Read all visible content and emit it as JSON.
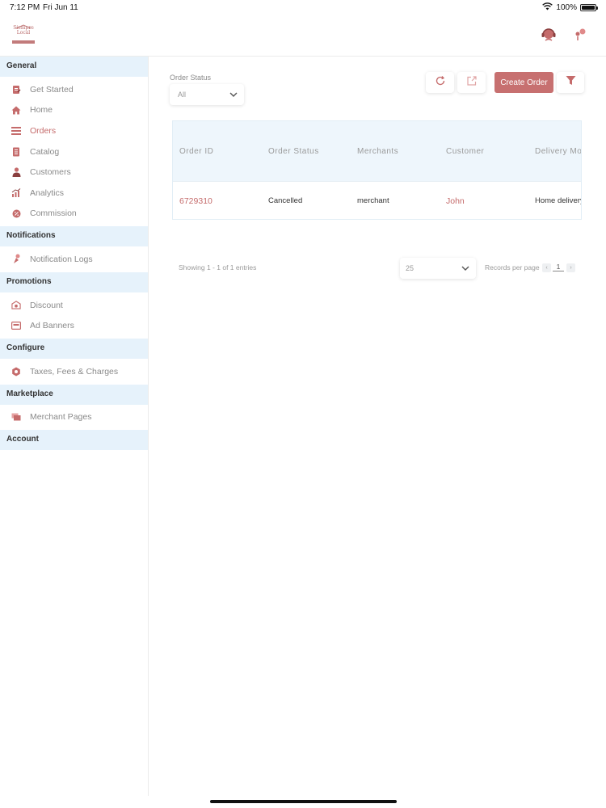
{
  "status_bar": {
    "time": "7:12 PM",
    "date": "Fri Jun 11",
    "battery": "100%",
    "battery_level": 1.0
  },
  "header": {
    "logo_text": "Siempre Local",
    "support_icon": "support-agent-icon",
    "notification_icon": "notification-icon"
  },
  "colors": {
    "accent": "#c56b6b",
    "button": "#c77070",
    "section_bg": "#e6f2fb",
    "table_header_bg": "#eef6fc"
  },
  "sidebar": {
    "sections": [
      {
        "title": "General",
        "items": [
          {
            "label": "Get Started",
            "icon": "get-started-icon"
          },
          {
            "label": "Home",
            "icon": "home-icon"
          },
          {
            "label": "Orders",
            "icon": "orders-icon",
            "active": true
          },
          {
            "label": "Catalog",
            "icon": "catalog-icon"
          },
          {
            "label": "Customers",
            "icon": "customers-icon"
          },
          {
            "label": "Analytics",
            "icon": "analytics-icon"
          },
          {
            "label": "Commission",
            "icon": "commission-icon"
          }
        ]
      },
      {
        "title": "Notifications",
        "items": [
          {
            "label": "Notification Logs",
            "icon": "notification-logs-icon"
          }
        ]
      },
      {
        "title": "Promotions",
        "items": [
          {
            "label": "Discount",
            "icon": "discount-icon"
          },
          {
            "label": "Ad Banners",
            "icon": "ad-banners-icon"
          }
        ]
      },
      {
        "title": "Configure",
        "items": [
          {
            "label": "Taxes, Fees & Charges",
            "icon": "taxes-icon"
          }
        ]
      },
      {
        "title": "Marketplace",
        "items": [
          {
            "label": "Merchant Pages",
            "icon": "merchant-pages-icon"
          }
        ]
      },
      {
        "title": "Account",
        "items": []
      }
    ]
  },
  "main": {
    "filter": {
      "label": "Order Status",
      "value": "All"
    },
    "toolbar": {
      "refresh_icon": "refresh-icon",
      "export_icon": "export-icon",
      "create_label": "Create Order",
      "filter_icon": "filter-icon"
    },
    "table": {
      "columns": [
        "Order ID",
        "Order Status",
        "Merchants",
        "Customer",
        "Delivery Mode"
      ],
      "rows": [
        [
          "6729310",
          "Cancelled",
          "merchant",
          "John",
          "Home delivery"
        ]
      ]
    },
    "footer": {
      "showing": "Showing 1 - 1 of 1 entries",
      "per_page_value": "25",
      "records_label": "Records per page",
      "prev": "‹",
      "page": "1",
      "next": "›"
    }
  }
}
